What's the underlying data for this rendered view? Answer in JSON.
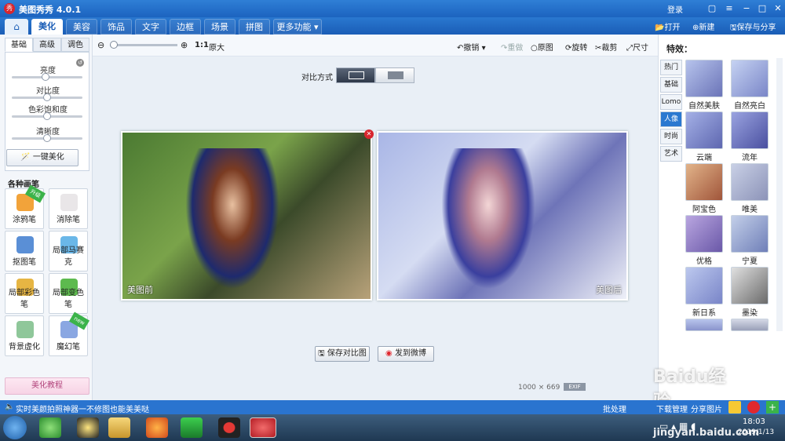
{
  "app": {
    "title": "美图秀秀 4.0.1",
    "login": "登录"
  },
  "menu": {
    "tabs": [
      "美化",
      "美容",
      "饰品",
      "文字",
      "边框",
      "场景",
      "拼图",
      "更多功能"
    ],
    "open": "打开",
    "new": "新建",
    "save": "保存与分享"
  },
  "toolbar": {
    "zoom_ratio": "1:1",
    "original_size": "原大",
    "undo": "撤销",
    "redo": "重做",
    "reset": "原图",
    "rotate": "旋转",
    "crop": "裁剪",
    "resize": "尺寸"
  },
  "compare": {
    "label": "对比方式"
  },
  "leftpanel": {
    "subtabs": [
      "基础",
      "高级",
      "调色"
    ],
    "sliders": [
      "亮度",
      "对比度",
      "色彩饱和度",
      "清晰度"
    ],
    "onekey": "一键美化",
    "brush_title": "各种画笔",
    "tools": [
      {
        "label": "涂鸦笔",
        "badge": "升级"
      },
      {
        "label": "消除笔",
        "badge": ""
      },
      {
        "label": "抠图笔",
        "badge": ""
      },
      {
        "label": "局部马赛克",
        "badge": ""
      },
      {
        "label": "局部彩色笔",
        "badge": ""
      },
      {
        "label": "局部变色笔",
        "badge": ""
      },
      {
        "label": "背景虚化",
        "badge": ""
      },
      {
        "label": "魔幻笔",
        "badge": "new"
      }
    ],
    "tutorial": "美化教程"
  },
  "main": {
    "before_label": "美图前",
    "after_label": "美图后",
    "save_compare": "保存对比图",
    "share_weibo": "发到微博",
    "dimensions": "1000 × 669"
  },
  "effects": {
    "title": "特效：",
    "categories": [
      "热门",
      "基础",
      "Lomo",
      "人像",
      "时尚",
      "艺术"
    ],
    "active_category": "人像",
    "items": [
      "自然美肤",
      "自然亮白",
      "云端",
      "流年",
      "阿宝色",
      "唯美",
      "优格",
      "宁夏",
      "新日系",
      "墨染"
    ]
  },
  "statusbar": {
    "message": "实时美颜拍照神器一不修图也能美美哒",
    "batch": "批处理",
    "download": "下载管理",
    "share": "分享图片"
  },
  "taskbar": {
    "time": "18:03",
    "date": "2019/1/13"
  },
  "watermark": {
    "text": "Baidu经验",
    "url": "jingyan.baidu.com"
  }
}
